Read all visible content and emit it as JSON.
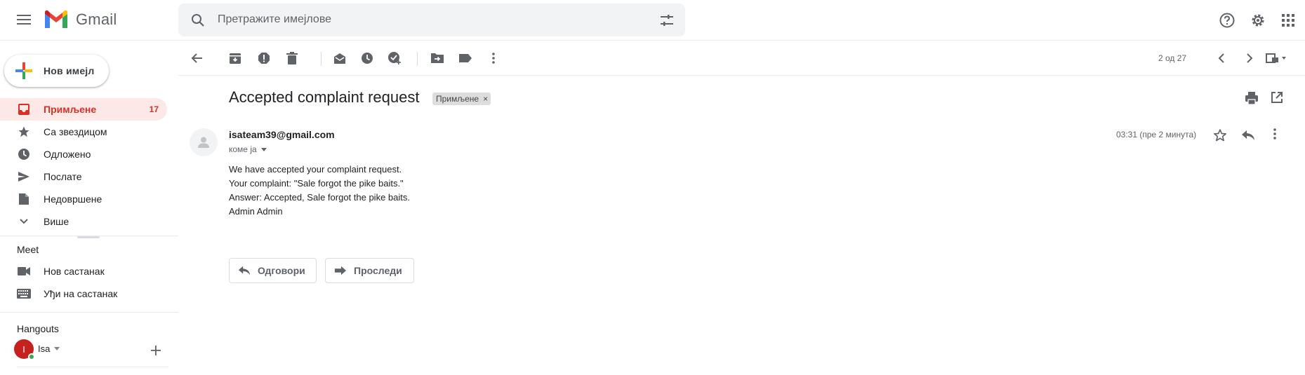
{
  "app": {
    "logo_text": "Gmail"
  },
  "search": {
    "placeholder": "Претражите имејлове",
    "value": ""
  },
  "sidebar": {
    "compose_label": "Нов имејл",
    "items": [
      {
        "label": "Примљене",
        "count": "17",
        "icon": "inbox-icon"
      },
      {
        "label": "Са звездицом",
        "icon": "star-icon"
      },
      {
        "label": "Одложено",
        "icon": "clock-icon"
      },
      {
        "label": "Послате",
        "icon": "send-icon"
      },
      {
        "label": "Недовршене",
        "icon": "draft-icon"
      },
      {
        "label": "Више",
        "icon": "chevron-down-icon"
      }
    ],
    "meet": {
      "title": "Meet",
      "items": [
        {
          "label": "Нов састанак",
          "icon": "video-icon"
        },
        {
          "label": "Уђи на састанак",
          "icon": "keyboard-icon"
        }
      ]
    },
    "hangouts": {
      "title": "Hangouts",
      "user_initial": "I",
      "user_name": "Isa"
    }
  },
  "toolbar": {
    "pager_text": "2 од 27"
  },
  "message": {
    "subject": "Accepted complaint request",
    "label": "Примљене",
    "sender": "isateam39@gmail.com",
    "to": "коме ја",
    "timestamp": "03:31 (пре 2 минута)",
    "body": [
      "We have accepted your complaint request.",
      "Your complaint: \"Sale forgot the pike baits.\"",
      "Answer: Accepted, Sale forgot the pike baits.",
      "Admin Admin"
    ],
    "reply_label": "Одговори",
    "forward_label": "Проследи"
  },
  "colors": {
    "accent_red": "#d93025",
    "active_bg": "#fce8e6",
    "icon_gray": "#5f6368"
  }
}
